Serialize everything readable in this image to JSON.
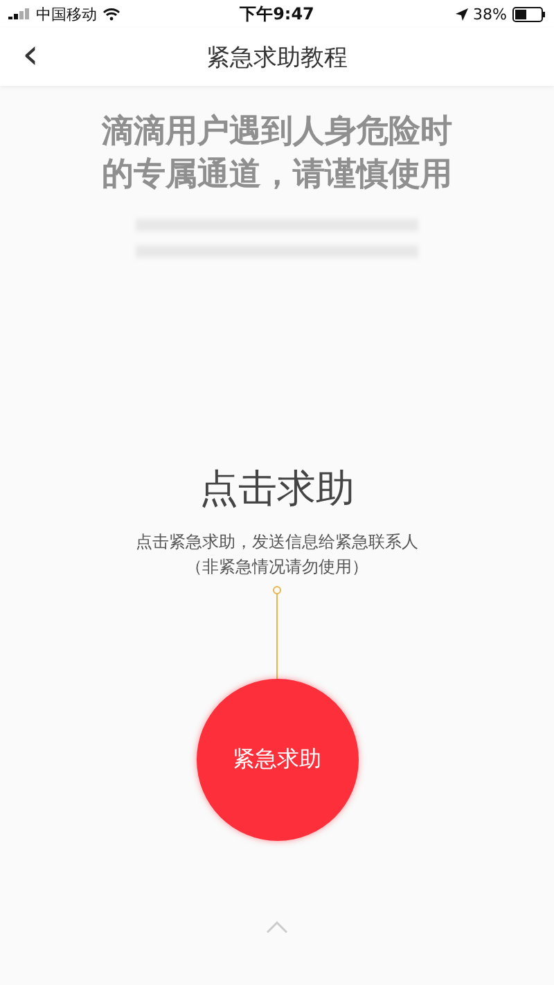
{
  "status_bar": {
    "carrier": "中国移动",
    "time": "下午9:47",
    "battery": "38%"
  },
  "nav": {
    "back": "‹",
    "title": "紧急求助教程"
  },
  "intro": {
    "headline": [
      "滴滴用户遇到人身危险时",
      "的专属通道，请谨慎使用"
    ]
  },
  "tip": {
    "title": "点击求助",
    "lines": [
      "点击紧急求助，发送信息给紧急联系人",
      "（非紧急情况请勿使用）"
    ]
  },
  "sos_button": {
    "label": "紧急求助"
  }
}
